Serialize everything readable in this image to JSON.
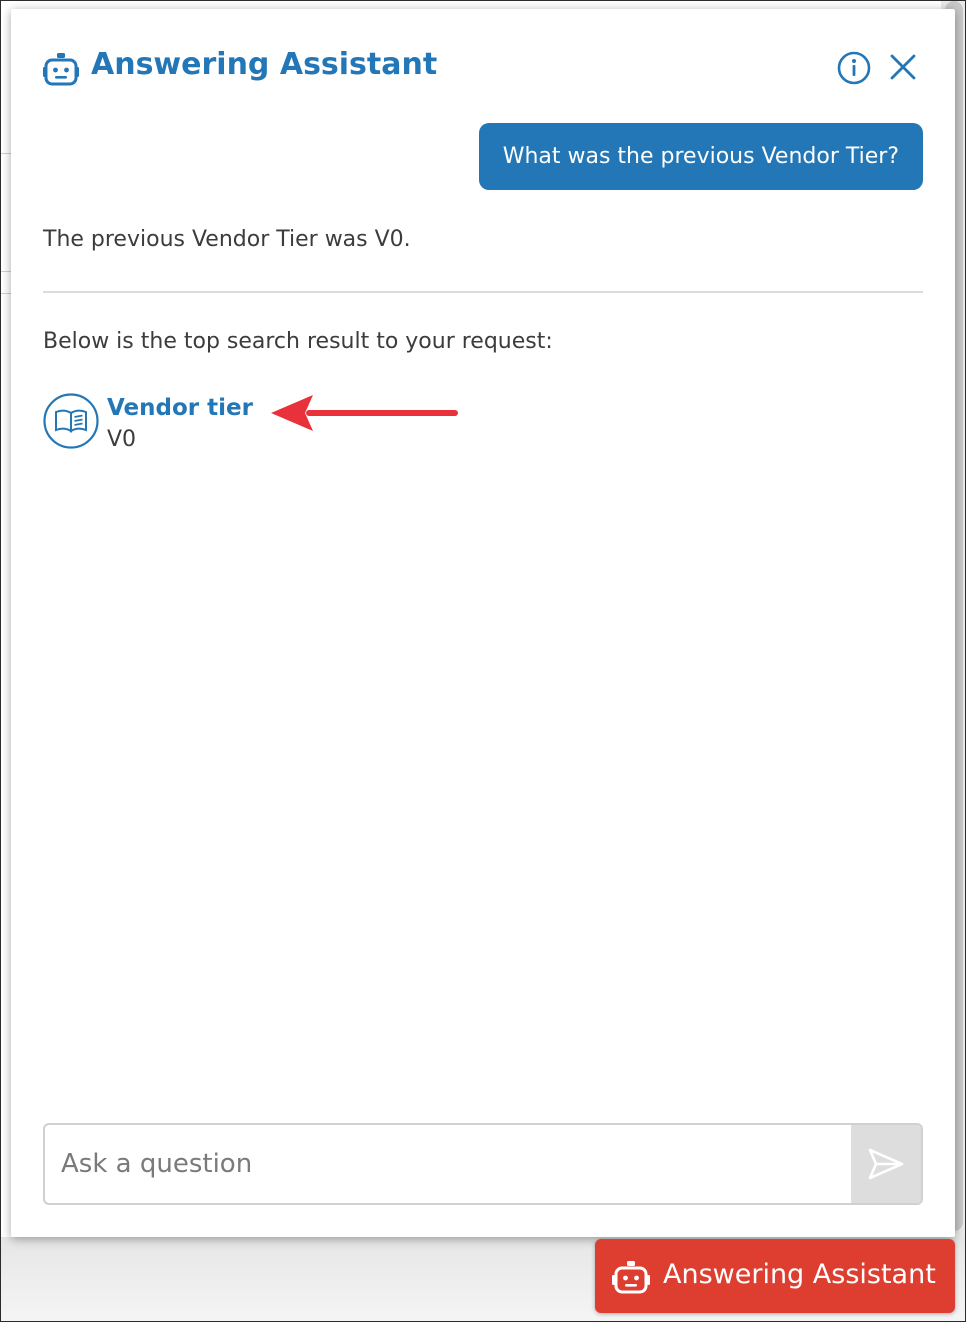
{
  "panel": {
    "title": "Answering Assistant",
    "icons": {
      "header": "robot-icon",
      "info": "info-icon",
      "close": "close-icon"
    }
  },
  "conversation": {
    "user_message": "What was the previous Vendor Tier?",
    "answer": "The previous Vendor Tier was V0.",
    "result_intro": "Below is the top search result to your request:",
    "top_result": {
      "icon": "book-icon",
      "title": "Vendor tier",
      "value": "V0"
    }
  },
  "input": {
    "placeholder": "Ask a question",
    "value": "",
    "send_icon": "send-icon"
  },
  "launcher": {
    "label": "Answering Assistant",
    "icon": "robot-icon"
  },
  "colors": {
    "brand_blue": "#2377b7",
    "launcher_red": "#dd3e30",
    "annotation_arrow": "#e8313a"
  }
}
